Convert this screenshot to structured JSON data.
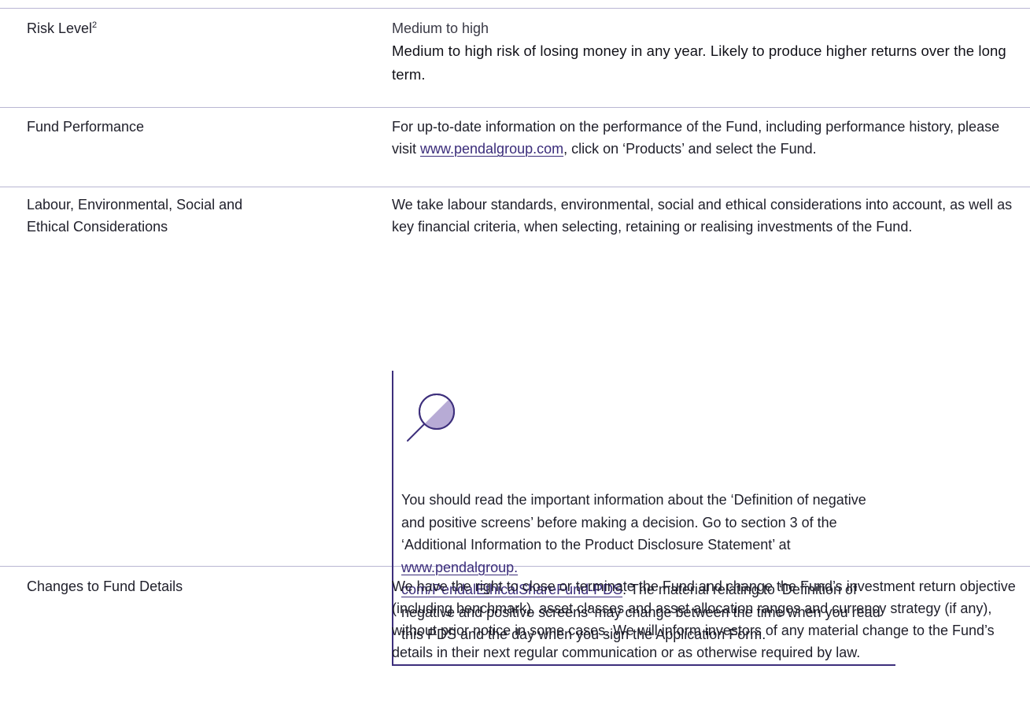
{
  "rows": [
    {
      "label": "Risk Level",
      "label_sup": "2",
      "content_lines": [
        "Medium to high",
        "Medium to high risk of losing money in any year. Likely to produce higher returns over the long term."
      ]
    },
    {
      "label": "Fund Performance",
      "content_text_before": "For up-to-date information on the performance of the Fund, including performance history, please visit ",
      "content_link": "www.pendalgroup.com",
      "content_text_after": ", click on ‘Products’ and select the Fund."
    },
    {
      "label_line1": "Labour, Environmental, Social and",
      "label_line2": "Ethical Considerations",
      "content_text": "We take labour standards, environmental, social and ethical considerations into account, as well as key financial criteria, when selecting, retaining or realising investments of the Fund."
    },
    {
      "label": "Changes to Fund Details",
      "content_text": "We have the right to close or terminate the Fund and change the Fund’s investment return objective (including benchmark), asset classes and asset allocation ranges and currency strategy (if any), without prior notice in some cases. We will inform investors of any material change to the Fund’s details in their next regular communication or as otherwise required by law."
    }
  ],
  "callout": {
    "icon": "magnifier-icon",
    "text_before": "You should read the important information about the ‘Definition of negative and positive screens’ before making a decision. Go to section 3 of the ‘Additional Information to the Product Disclosure Statement’ at ",
    "link_part1": "www.pendalgroup.",
    "link_part2": "com/PendalEthicalShareFund-PDS",
    "text_after": ". The material relating to ‘Definition of negative and positive screens’ may change between the time when you read this PDS and the day when you sign the Application Form."
  },
  "colors": {
    "rule": "#b9b6d3",
    "accent": "#3d2f7c",
    "icon_fill": "#b7abd5"
  }
}
